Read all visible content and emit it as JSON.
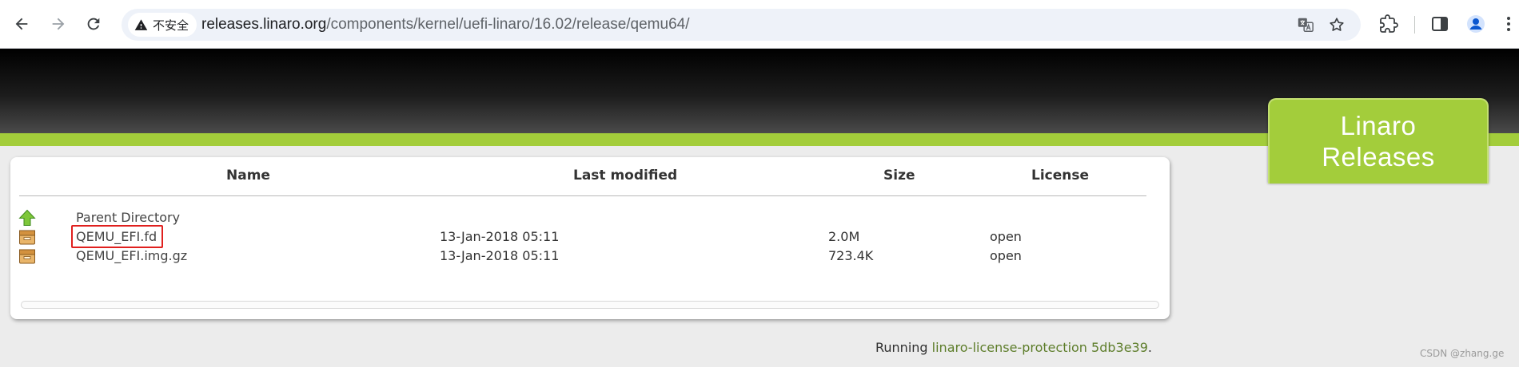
{
  "browser": {
    "security_label": "不安全",
    "url_host": "releases.linaro.org",
    "url_path": "/components/kernel/uefi-linaro/16.02/release/qemu64/"
  },
  "header": {
    "logo_line1": "Linaro",
    "logo_line2": "Releases"
  },
  "table": {
    "columns": [
      "Name",
      "Last modified",
      "Size",
      "License"
    ],
    "parent": "Parent Directory",
    "rows": [
      {
        "name": "QEMU_EFI.fd",
        "modified": "13-Jan-2018 05:11",
        "size": "2.0M",
        "license": "open"
      },
      {
        "name": "QEMU_EFI.img.gz",
        "modified": "13-Jan-2018 05:11",
        "size": "723.4K",
        "license": "open"
      }
    ]
  },
  "footer": {
    "prefix": "Running ",
    "link": "linaro-license-protection 5db3e39",
    "suffix": "."
  },
  "watermark": "CSDN @zhang.ge",
  "colors": {
    "accent_green": "#a3cd3b",
    "highlight_red": "#e0201e",
    "link_green": "#5d7d2a"
  }
}
